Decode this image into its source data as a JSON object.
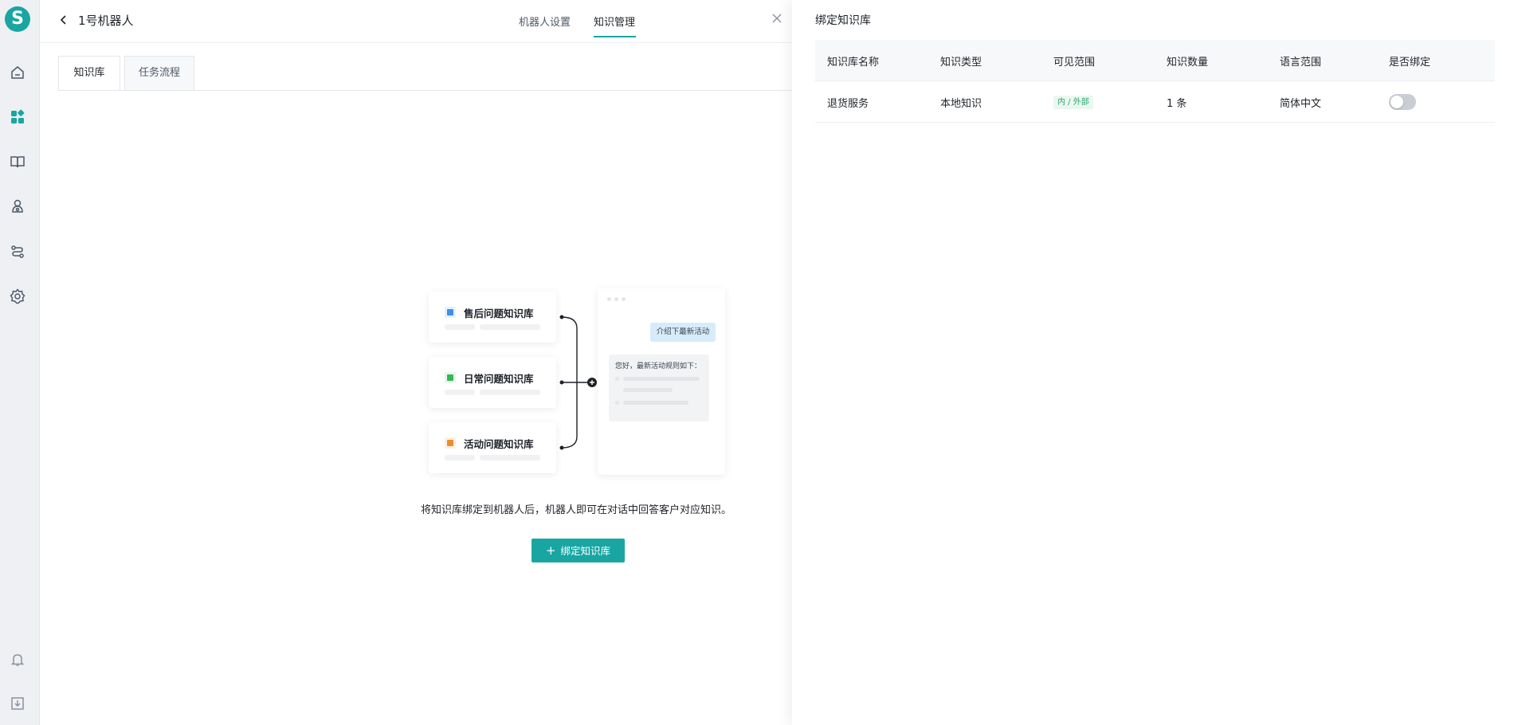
{
  "app": {
    "logo_letter": "S"
  },
  "header": {
    "bot_name": "1号机器人",
    "tabs": [
      "机器人设置",
      "知识管理"
    ],
    "active_tab": "知识管理"
  },
  "sub_tabs": [
    "知识库",
    "任务流程"
  ],
  "illustration": {
    "kb_cards": [
      {
        "title": "售后问题知识库",
        "color": "#3d8fe8"
      },
      {
        "title": "日常问题知识库",
        "color": "#34b84f"
      },
      {
        "title": "活动问题知识库",
        "color": "#f08c2b"
      }
    ],
    "chat_question": "介绍下最新活动",
    "chat_answer": "您好，最新活动规则如下："
  },
  "empty_state": {
    "description": "将知识库绑定到机器人后，机器人即可在对话中回答客户对应知识。",
    "button_label": "绑定知识库"
  },
  "panel": {
    "title": "绑定知识库",
    "columns": [
      "知识库名称",
      "知识类型",
      "可见范围",
      "知识数量",
      "语言范围",
      "是否绑定"
    ],
    "rows": [
      {
        "name": "退货服务",
        "type": "本地知识",
        "scope": "内 / 外部",
        "count": "1 条",
        "language": "简体中文",
        "bound": false
      }
    ]
  },
  "colors": {
    "accent": "#19a6a2"
  }
}
